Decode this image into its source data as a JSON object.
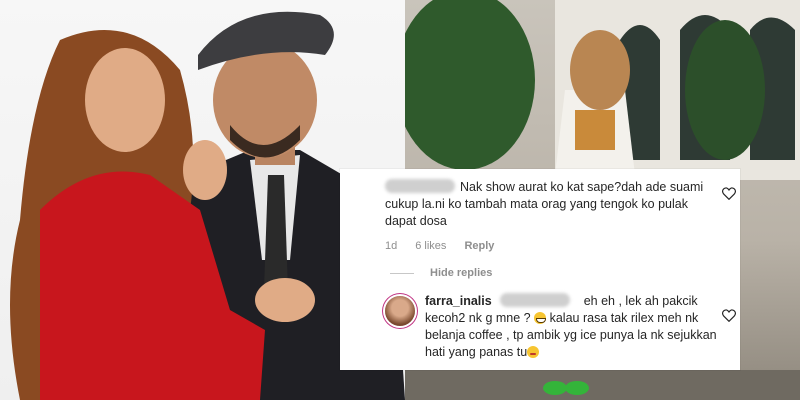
{
  "comments": [
    {
      "text": "Nak show aurat ko kat sape?dah ade suami cukup la.ni ko tambah mata orag yang tengok ko pulak dapat dosa",
      "time": "1d",
      "likes": "6 likes",
      "reply_label": "Reply"
    }
  ],
  "hide_replies_label": "Hide replies",
  "reply": {
    "username": "farra_inalis",
    "text_line1": "eh eh , lek ah pakcik",
    "text_line2": "kecoh2 nk g mne ?",
    "text_line3": "kalau rasa tak rilex meh nk",
    "text_line4": "belanja coffee , tp ambik yg ice punya la nk sejukkan",
    "text_line5": "hati yang panas tu"
  },
  "icons": [
    "heart-icon",
    "grinning-emoji-icon",
    "wink-tongue-emoji-icon"
  ],
  "colors": {
    "text": "#262626",
    "meta": "#8e8e8e",
    "blazer": "#c8161d",
    "card_bg": "#ffffff"
  }
}
